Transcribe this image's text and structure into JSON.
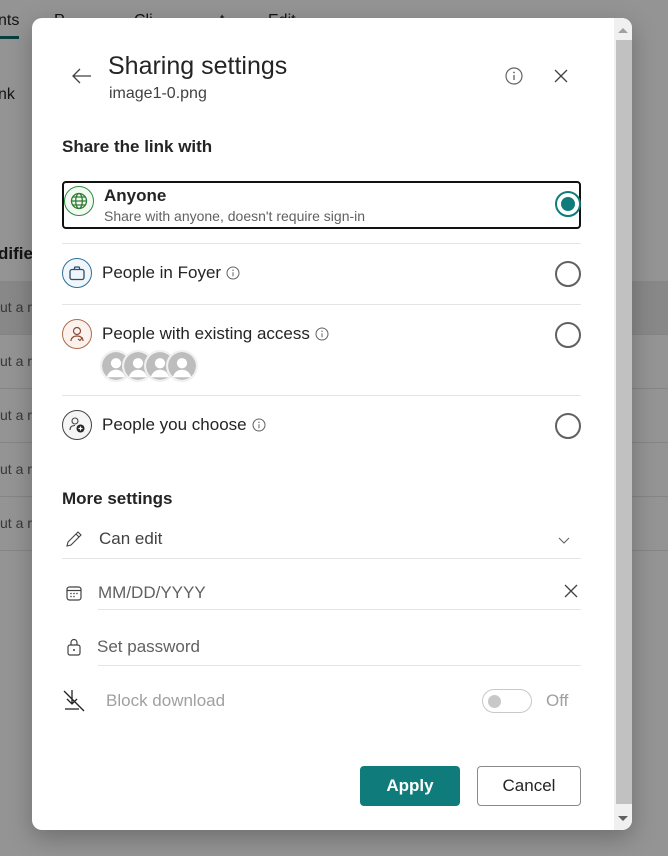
{
  "background": {
    "tabs": [
      "nts",
      "P",
      "Cli",
      "t",
      "Edit"
    ],
    "link_fragment": "nk",
    "column_fragment": "difie",
    "rows": [
      "ut a r",
      "ut a r",
      "ut a r",
      "ut a r",
      "ut a r"
    ]
  },
  "dialog": {
    "title": "Sharing settings",
    "filename": "image1-0.png",
    "back_icon": "arrow-left-icon",
    "info_icon": "info-icon",
    "close_icon": "close-icon",
    "share_section_label": "Share the link with",
    "options": [
      {
        "label": "Anyone",
        "description": "Share with anyone, doesn't require sign-in",
        "icon": "globe-icon",
        "selected": true,
        "has_info": false
      },
      {
        "label": "People in Foyer",
        "icon": "briefcase-icon",
        "selected": false,
        "has_info": true
      },
      {
        "label": "People with existing access",
        "icon": "person-sync-icon",
        "selected": false,
        "has_info": true,
        "avatar_count": 4
      },
      {
        "label": "People you choose",
        "icon": "people-add-icon",
        "selected": false,
        "has_info": true
      }
    ],
    "more_settings_label": "More settings",
    "permission": {
      "value": "Can edit",
      "icon": "pencil-icon",
      "chevron": "chevron-down-icon"
    },
    "expiration": {
      "placeholder": "MM/DD/YYYY",
      "icon": "calendar-icon",
      "clear_icon": "close-icon"
    },
    "password": {
      "placeholder": "Set password",
      "icon": "lock-icon"
    },
    "block_download": {
      "label": "Block download",
      "icon": "download-blocked-icon",
      "state": "Off",
      "enabled": false
    },
    "apply_label": "Apply",
    "cancel_label": "Cancel",
    "accent_color": "#0f7b7b"
  }
}
